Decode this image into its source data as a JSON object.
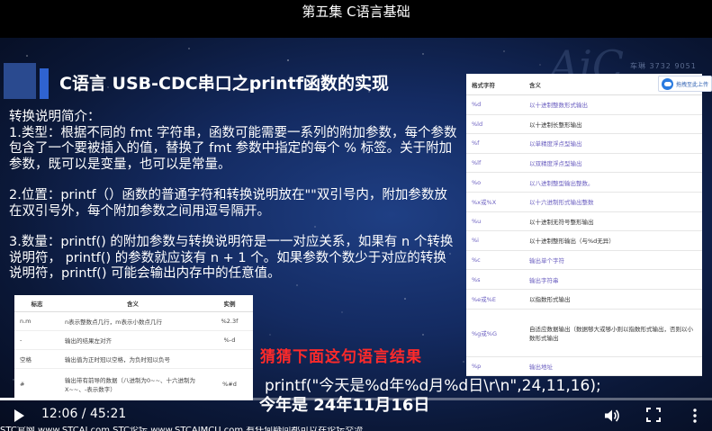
{
  "page": {
    "title": "第五集 C语言基础"
  },
  "slide": {
    "title": "C语言 USB-CDC串口之printf函数的实现",
    "paragraphs": [
      "转换说明简介：",
      "1.类型：根据不同的 fmt 字符串，函数可能需要一系列的附加参数，每个参数包含了一个要被插入的值，替换了 fmt 参数中指定的每个 % 标签。关于附加参数，既可以是变量，也可以是常量。",
      "",
      "2.位置：printf（）函数的普通字符和转换说明放在\"\"双引号内，附加参数放在双引号外，每个附加参数之间用逗号隔开。",
      "",
      "3.数量：printf() 的附加参数与转换说明符是一一对应关系，如果有 n 个转换说明符， printf() 的参数就应该有 n + 1 个。如果参数个数少于对应的转换说明符，printf() 可能会输出内存中的任意值。"
    ],
    "question": "猜猜下面这句语言结果",
    "code": "printf(\"今天是%d年%d月%d日\\r\\n\",24,11,16);",
    "result": "今年是 24年11月16日",
    "watermark_lines": [
      "AiC",
      "车琳 3732 9051"
    ]
  },
  "format_table": {
    "headers": [
      "格式字符",
      "含义"
    ],
    "rows": [
      {
        "code": "%d",
        "meaning": "以十进制整数形式输出"
      },
      {
        "code": "%ld",
        "meaning": "以十进制长整形输出"
      },
      {
        "code": "%f",
        "meaning": "以单精度浮点型输出"
      },
      {
        "code": "%lf",
        "meaning": "以双精度浮点型输出"
      },
      {
        "code": "%o",
        "meaning": "以八进制整型输出整数。"
      },
      {
        "code": "%x或%X",
        "meaning": "以十六进制形式输出整数"
      },
      {
        "code": "%u",
        "meaning": "以十进制无符号整形输出"
      },
      {
        "code": "%i",
        "meaning": "以十进制整形输出（与%d无异）"
      },
      {
        "code": "%c",
        "meaning": "输出单个字符"
      },
      {
        "code": "%s",
        "meaning": "输出字符串"
      },
      {
        "code": "%e或%E",
        "meaning": "以指数形式输出"
      },
      {
        "code": "%g或%G",
        "meaning": "自适应数据输出（数据够大或够小则以指数形式输出，否则以小数形式输出"
      },
      {
        "code": "%p",
        "meaning": "输出地址"
      }
    ]
  },
  "upload_tag": {
    "label": "拖拽至此上传"
  },
  "flag_table": {
    "headers": [
      "标志",
      "含义",
      "实例"
    ],
    "rows": [
      {
        "flag": "n.m",
        "meaning": "n表示整数点几行，m表示小数点几行",
        "example": "%2.3f"
      },
      {
        "flag": "-",
        "meaning": "输出的结果左对齐",
        "example": "%-d"
      },
      {
        "flag": "空格",
        "meaning": "输出值为正时冠以空格，为负时冠以负号",
        "example": ""
      },
      {
        "flag": "#",
        "meaning": "输出带有前导的数据（八进制为0~~、十六进制为X~~、-表示数字）",
        "example": "%#d"
      }
    ]
  },
  "player": {
    "current_time": "12:06",
    "separator": " / ",
    "duration": "45:21",
    "progress_fraction": 0.267,
    "controls": [
      "play-icon",
      "volume-icon",
      "fullscreen-icon",
      "more-icon"
    ]
  },
  "bottom_strip": {
    "text": "STC官网 www.STCAI.com   STC论坛 www.STCAIMCU.com   有任何疑问都可以在论坛交流"
  },
  "colors": {
    "accent_purple": "#6b5fc0",
    "question_red": "#ff2a2a",
    "title_bar_blue": "#2f63d0",
    "background_navy": "#142b62"
  }
}
